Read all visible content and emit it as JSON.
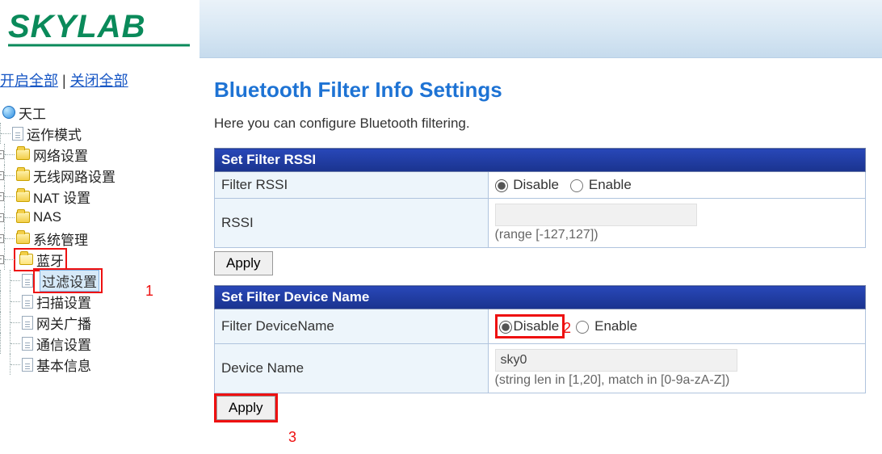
{
  "brand": "SKYLAB",
  "sidelinks": {
    "open_all": "开启全部",
    "sep": " | ",
    "close_all": "关闭全部"
  },
  "nav": {
    "root": "天工",
    "op_mode": "运作模式",
    "net_settings": "网络设置",
    "wlan_settings": "无线网路设置",
    "nat_settings": "NAT 设置",
    "nas": "NAS",
    "sys_mgmt": "系统管理",
    "bluetooth": "蓝牙",
    "filter_settings": "过滤设置",
    "scan_settings": "扫描设置",
    "gw_broadcast": "网关广播",
    "comm_settings": "通信设置",
    "basic_info": "基本信息"
  },
  "annot": {
    "a1": "1",
    "a2": "2",
    "a3": "3"
  },
  "page": {
    "title": "Bluetooth Filter Info Settings",
    "intro": "Here you can configure Bluetooth filtering.",
    "section_rssi": "Set Filter RSSI",
    "row_filter_rssi": "Filter RSSI",
    "row_rssi": "RSSI",
    "rssi_value": "",
    "rssi_hint": "(range [-127,127])",
    "section_devname": "Set Filter Device Name",
    "row_filter_devname": "Filter DeviceName",
    "row_devname": "Device Name",
    "devname_value": "sky0",
    "devname_hint": "(string len in [1,20], match in [0-9a-zA-Z])",
    "opt_disable": "Disable",
    "opt_enable": "Enable",
    "btn_apply": "Apply"
  }
}
